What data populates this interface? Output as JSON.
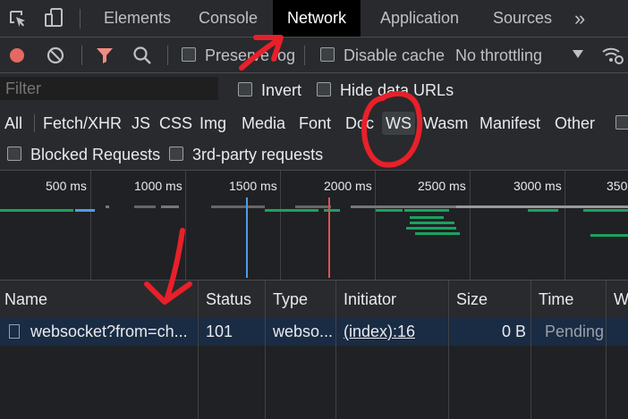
{
  "tabs": [
    {
      "label": "Elements"
    },
    {
      "label": "Console"
    },
    {
      "label": "Network",
      "active": true
    },
    {
      "label": "Application"
    },
    {
      "label": "Sources"
    }
  ],
  "tabs_overflow": "»",
  "toolbar": {
    "preserve_log": "Preserve log",
    "disable_cache": "Disable cache",
    "throttling": "No throttling"
  },
  "filter": {
    "placeholder": "Filter",
    "invert": "Invert",
    "hide_data_urls": "Hide data URLs"
  },
  "types": [
    "All",
    "Fetch/XHR",
    "JS",
    "CSS",
    "Img",
    "Media",
    "Font",
    "Doc",
    "WS",
    "Wasm",
    "Manifest",
    "Other"
  ],
  "selected_type": "WS",
  "options": {
    "blocked_requests": "Blocked Requests",
    "third_party": "3rd-party requests"
  },
  "timeline": {
    "ticks": [
      "500 ms",
      "1000 ms",
      "1500 ms",
      "2000 ms",
      "2500 ms",
      "3000 ms",
      "350"
    ]
  },
  "table": {
    "columns": [
      "Name",
      "Status",
      "Type",
      "Initiator",
      "Size",
      "Time",
      "W"
    ],
    "rows": [
      {
        "name": "websocket?from=ch...",
        "status": "101",
        "type": "webso...",
        "initiator": "(index):16",
        "size": "0 B",
        "time": "Pending"
      }
    ]
  },
  "colors": {
    "annotation": "#e8202a",
    "record": "#e46962",
    "filter_active": "#f28b82",
    "green_bar": "#1aa260",
    "blue_bar": "#4f9ce6"
  }
}
